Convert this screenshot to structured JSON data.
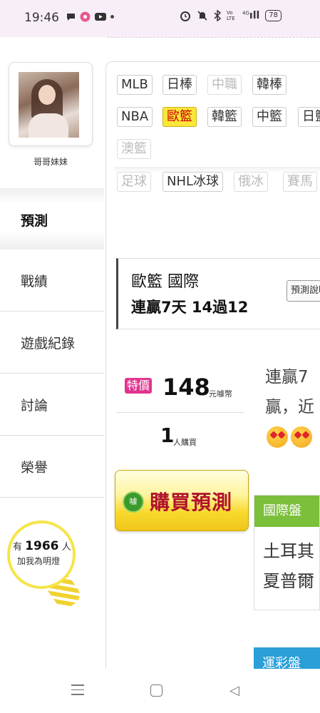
{
  "status_bar": {
    "time": "19:46",
    "network": "4G",
    "volte": "Vo LTE",
    "battery": "78"
  },
  "sidebar": {
    "user_name": "哥哥妹妹",
    "nav": [
      {
        "label": "預測",
        "active": true
      },
      {
        "label": "戰績",
        "active": false
      },
      {
        "label": "遊戲紀錄",
        "active": false
      },
      {
        "label": "討論",
        "active": false
      },
      {
        "label": "榮譽",
        "active": false
      }
    ],
    "lamp": {
      "prefix": "有",
      "count": "1966",
      "suffix": "人",
      "text": "加我為明燈"
    }
  },
  "tags": {
    "row1": [
      "MLB",
      "日棒",
      "中職",
      "韓棒"
    ],
    "row2": [
      "NBA",
      "歐籃",
      "韓籃",
      "中籃",
      "日籃"
    ],
    "row3": [
      "澳籃"
    ],
    "row4": [
      "足球",
      "NHL冰球",
      "俄冰",
      "賽馬"
    ]
  },
  "prediction": {
    "title": "歐籃 國際",
    "streak": "連贏7天 14過12",
    "button": "預測說明",
    "special_label": "特價",
    "price": "148",
    "price_unit": "元噱幣",
    "buyers": "1",
    "buyers_unit": "人購買",
    "buy_button": "購買預測",
    "coin_text": "噱",
    "desc_line1": "連贏7",
    "desc_line2": "贏，近",
    "intl_header": "國際盤",
    "intl_line1": "土耳其",
    "intl_line2": "夏普爾",
    "lottery_header": "運彩盤"
  },
  "colors": {
    "accent_yellow": "#fbe63a",
    "special_pink": "#e0348f",
    "intl_green": "#7bbf3a",
    "lottery_blue": "#2a9fd8",
    "buy_text_red": "#b0122c"
  }
}
